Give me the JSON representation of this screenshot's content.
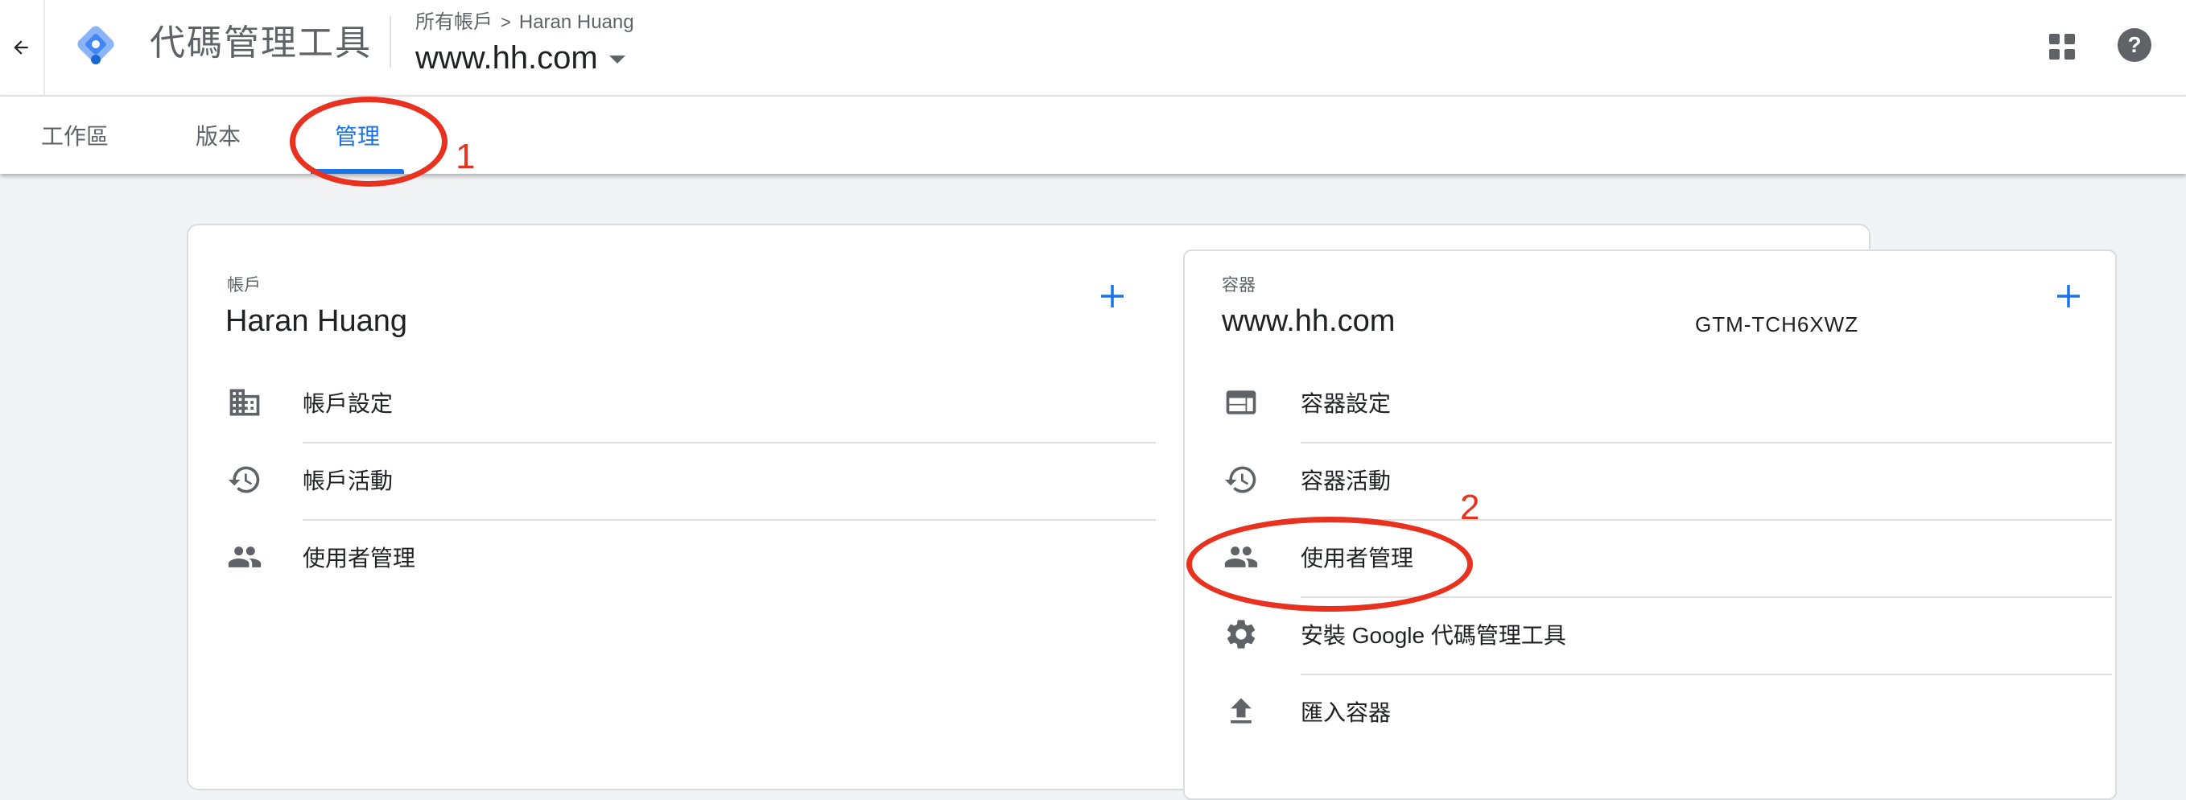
{
  "header": {
    "app_title": "代碼管理工具",
    "breadcrumb_all": "所有帳戶",
    "breadcrumb_sep": ">",
    "breadcrumb_account": "Haran Huang",
    "container_name": "www.hh.com"
  },
  "tabs": [
    {
      "label": "工作區"
    },
    {
      "label": "版本"
    },
    {
      "label": "管理",
      "active": true
    }
  ],
  "account": {
    "section_label": "帳戶",
    "name": "Haran Huang",
    "items": [
      {
        "label": "帳戶設定",
        "icon": "building-icon"
      },
      {
        "label": "帳戶活動",
        "icon": "history-icon"
      },
      {
        "label": "使用者管理",
        "icon": "people-icon"
      }
    ]
  },
  "container": {
    "section_label": "容器",
    "name": "www.hh.com",
    "id": "GTM-TCH6XWZ",
    "items": [
      {
        "label": "容器設定",
        "icon": "container-settings-icon"
      },
      {
        "label": "容器活動",
        "icon": "history-icon"
      },
      {
        "label": "使用者管理",
        "icon": "people-icon"
      },
      {
        "label": "安裝 Google 代碼管理工具",
        "icon": "gear-icon"
      },
      {
        "label": "匯入容器",
        "icon": "upload-icon"
      }
    ]
  },
  "annotations": {
    "one": "1",
    "two": "2"
  },
  "colors": {
    "accent": "#1a73e8",
    "annotation": "#e8321f",
    "icon": "#5f6368"
  }
}
